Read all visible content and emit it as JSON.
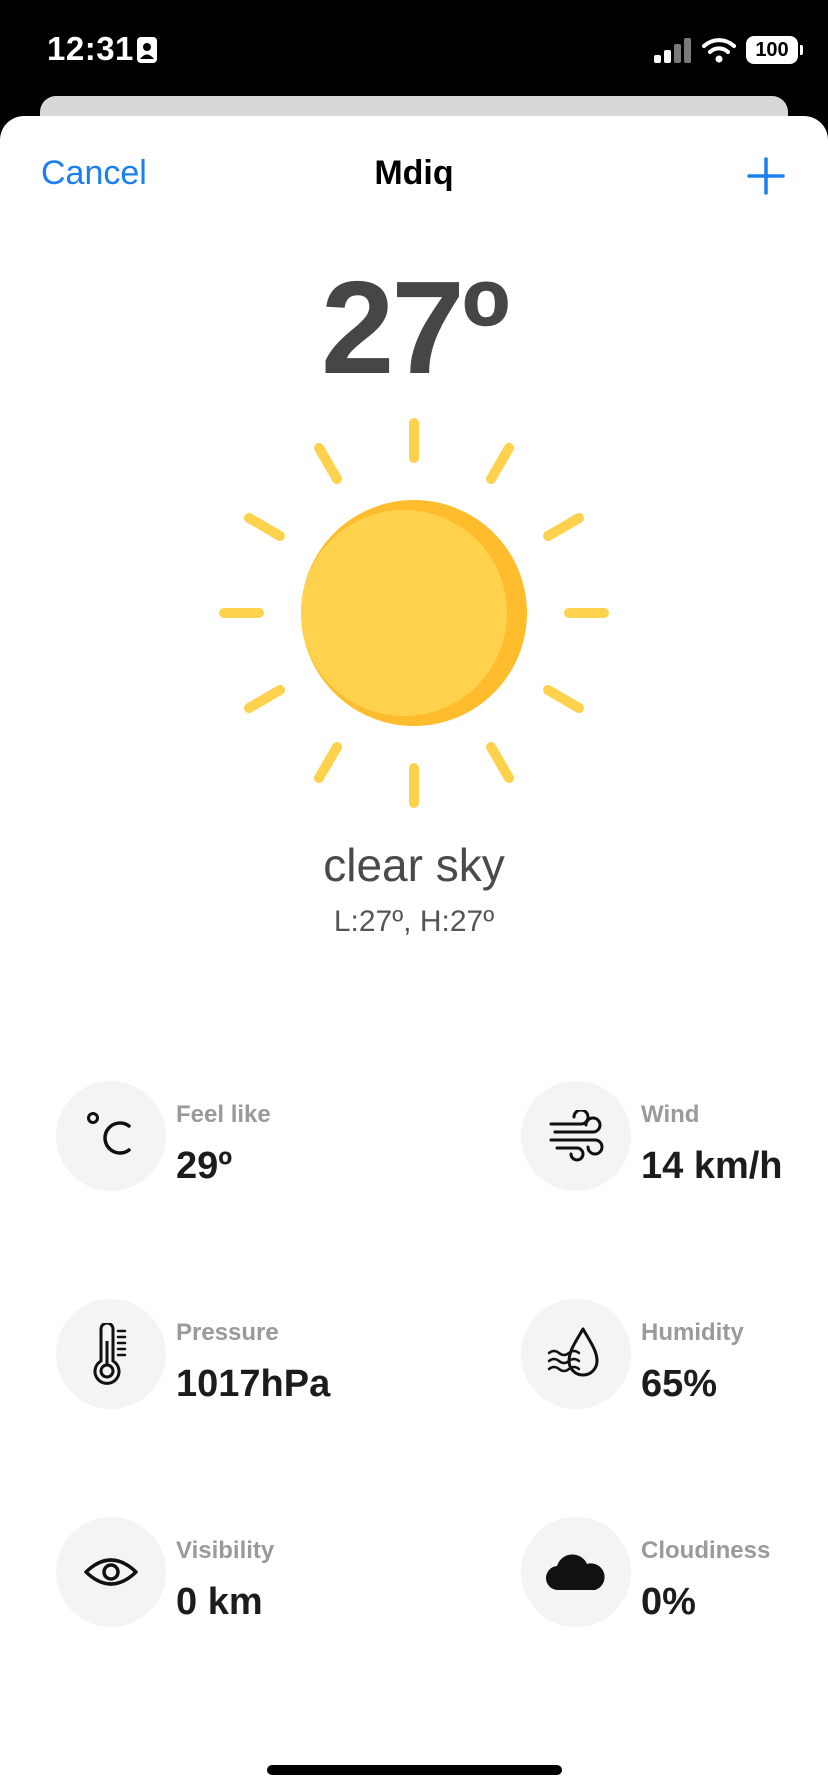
{
  "status_bar": {
    "time": "12:31",
    "battery": "100",
    "icons": [
      "contact-card-icon",
      "cellular-signal-icon",
      "wifi-icon",
      "battery-icon"
    ]
  },
  "nav": {
    "cancel_label": "Cancel",
    "title": "Mdiq",
    "add_icon": "plus-icon"
  },
  "weather": {
    "temperature": "27º",
    "icon": "sun-icon",
    "condition": "clear sky",
    "low_high": "L:27º, H:27º"
  },
  "stats": [
    {
      "label": "Feel like",
      "value": "29º",
      "icon": "celsius-icon"
    },
    {
      "label": "Wind",
      "value": "14 km/h",
      "icon": "wind-icon"
    },
    {
      "label": "Pressure",
      "value": "1017hPa",
      "icon": "thermometer-icon"
    },
    {
      "label": "Humidity",
      "value": "65%",
      "icon": "humidity-drop-icon"
    },
    {
      "label": "Visibility",
      "value": "0 km",
      "icon": "eye-icon"
    },
    {
      "label": "Cloudiness",
      "value": "0%",
      "icon": "cloud-icon"
    }
  ],
  "colors": {
    "accent": "#1a7ff0",
    "sun": "#ffd24d",
    "sun_shade": "#ffbd2e",
    "temp_text": "#464646"
  }
}
